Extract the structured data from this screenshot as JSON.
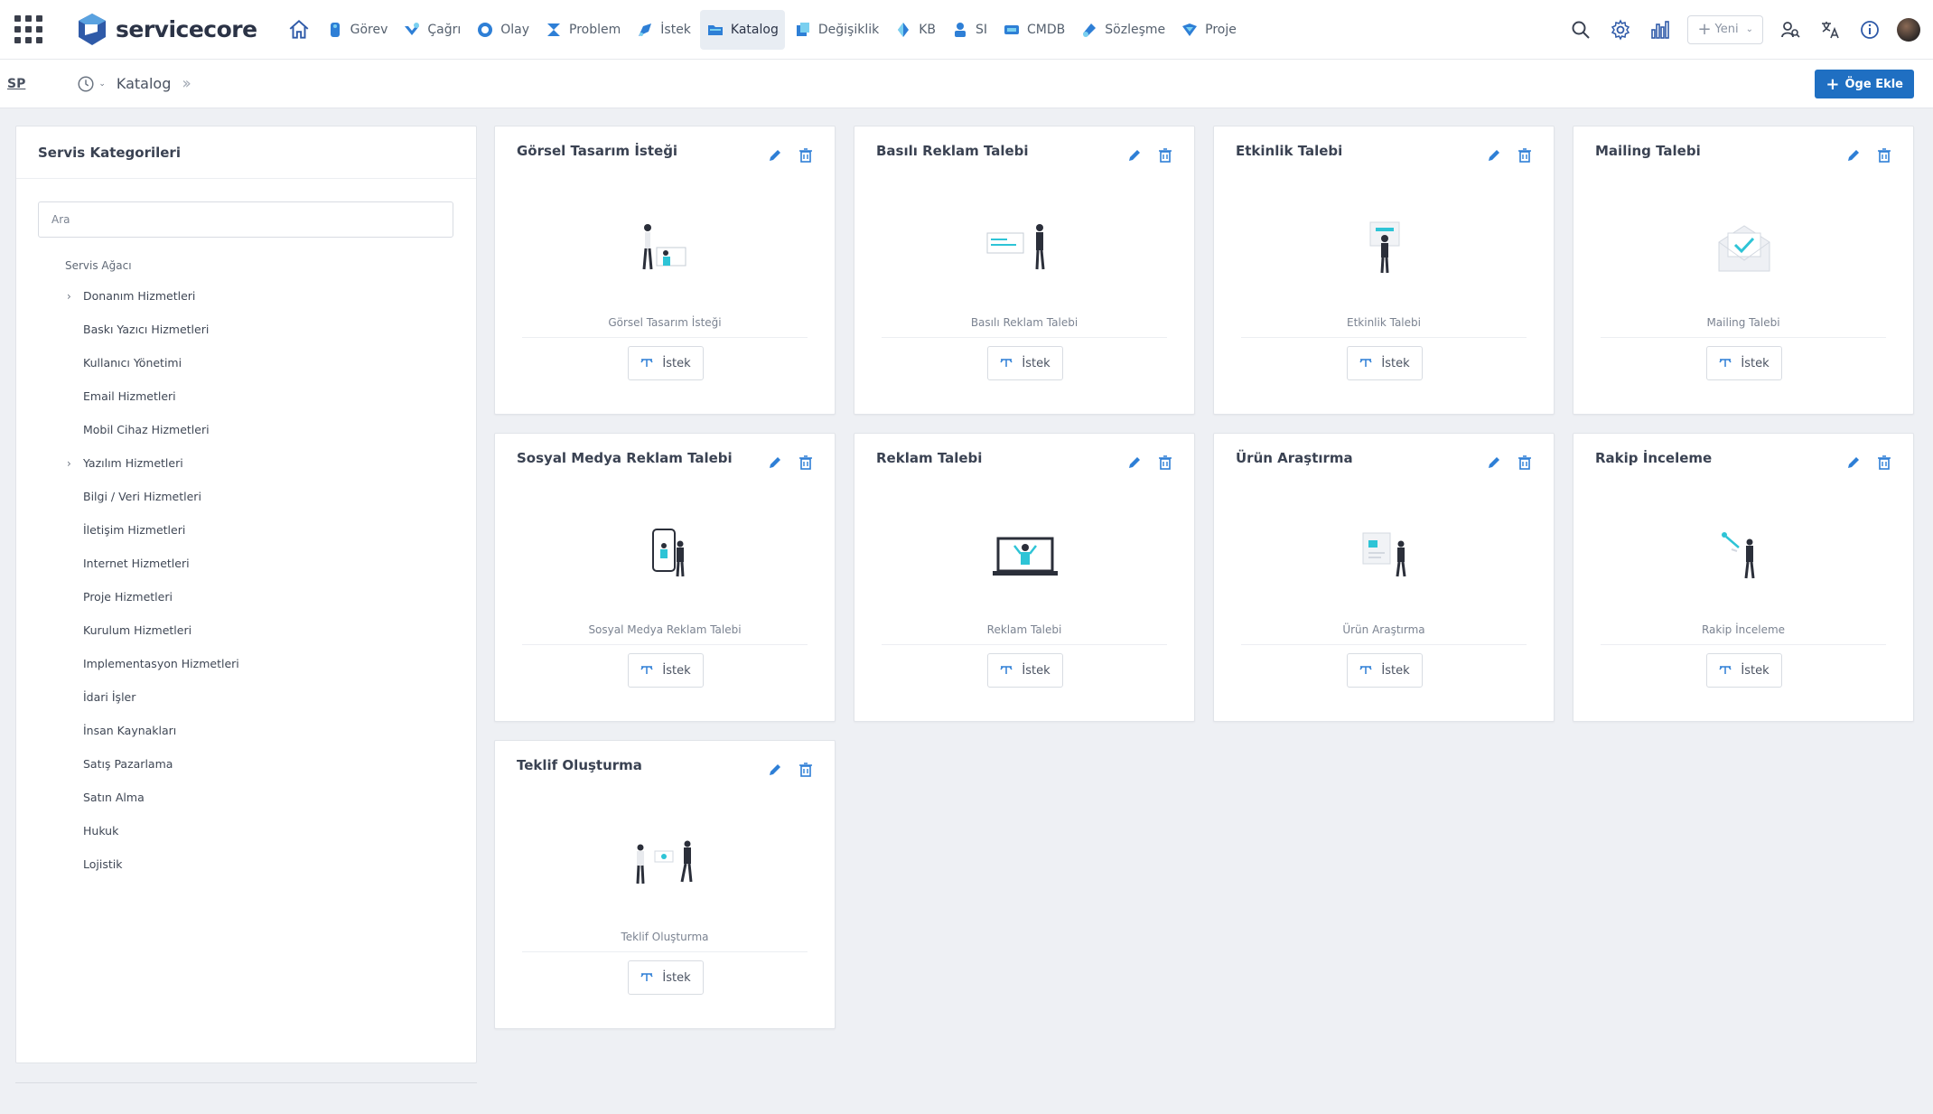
{
  "app": {
    "brand": "servicecore",
    "nav": [
      {
        "label": "",
        "icon": "home-icon"
      },
      {
        "label": "Görev",
        "icon": "task-icon"
      },
      {
        "label": "Çağrı",
        "icon": "call-icon"
      },
      {
        "label": "Olay",
        "icon": "incident-icon"
      },
      {
        "label": "Problem",
        "icon": "problem-icon"
      },
      {
        "label": "İstek",
        "icon": "request-icon"
      },
      {
        "label": "Katalog",
        "icon": "catalog-icon",
        "active": true
      },
      {
        "label": "Değişiklik",
        "icon": "change-icon"
      },
      {
        "label": "KB",
        "icon": "knowledge-base-icon"
      },
      {
        "label": "SI",
        "icon": "si-icon"
      },
      {
        "label": "CMDB",
        "icon": "cmdb-icon"
      },
      {
        "label": "Sözleşme",
        "icon": "contract-icon"
      },
      {
        "label": "Proje",
        "icon": "project-icon"
      }
    ],
    "new_button": "Yeni"
  },
  "subbar": {
    "sp": "SP",
    "breadcrumb": "Katalog",
    "add_item": "Öge Ekle"
  },
  "sidebar": {
    "title": "Servis Kategorileri",
    "search_placeholder": "Ara",
    "tree_root": "Servis Ağacı",
    "items": [
      {
        "label": "Donanım Hizmetleri",
        "expandable": true
      },
      {
        "label": "Baskı Yazıcı Hizmetleri",
        "expandable": false
      },
      {
        "label": "Kullanıcı Yönetimi",
        "expandable": false
      },
      {
        "label": "Email Hizmetleri",
        "expandable": false
      },
      {
        "label": "Mobil Cihaz Hizmetleri",
        "expandable": false
      },
      {
        "label": "Yazılım Hizmetleri",
        "expandable": true
      },
      {
        "label": "Bilgi / Veri Hizmetleri",
        "expandable": false
      },
      {
        "label": "İletişim Hizmetleri",
        "expandable": false
      },
      {
        "label": "Internet Hizmetleri",
        "expandable": false
      },
      {
        "label": "Proje Hizmetleri",
        "expandable": false
      },
      {
        "label": "Kurulum Hizmetleri",
        "expandable": false
      },
      {
        "label": "Implementasyon Hizmetleri",
        "expandable": false
      },
      {
        "label": "İdari İşler",
        "expandable": false
      },
      {
        "label": "İnsan Kaynakları",
        "expandable": false
      },
      {
        "label": "Satış Pazarlama",
        "expandable": false
      },
      {
        "label": "Satın Alma",
        "expandable": false
      },
      {
        "label": "Hukuk",
        "expandable": false
      },
      {
        "label": "Lojistik",
        "expandable": false
      }
    ]
  },
  "cards": [
    {
      "title": "Görsel Tasarım İsteği",
      "caption": "Görsel Tasarım İsteği",
      "button": "İstek",
      "illustration": "design-illustration"
    },
    {
      "title": "Basılı Reklam Talebi",
      "caption": "Basılı Reklam Talebi",
      "button": "İstek",
      "illustration": "print-ad-illustration"
    },
    {
      "title": "Etkinlik Talebi",
      "caption": "Etkinlik Talebi",
      "button": "İstek",
      "illustration": "event-illustration"
    },
    {
      "title": "Mailing Talebi",
      "caption": "Mailing Talebi",
      "button": "İstek",
      "illustration": "mailing-illustration"
    },
    {
      "title": "Sosyal Medya Reklam Talebi",
      "caption": "Sosyal Medya Reklam Talebi",
      "button": "İstek",
      "illustration": "social-media-illustration"
    },
    {
      "title": "Reklam Talebi",
      "caption": "Reklam Talebi",
      "button": "İstek",
      "illustration": "ad-request-illustration"
    },
    {
      "title": "Ürün Araştırma",
      "caption": "Ürün Araştırma",
      "button": "İstek",
      "illustration": "product-research-illustration"
    },
    {
      "title": "Rakip İnceleme",
      "caption": "Rakip İnceleme",
      "button": "İstek",
      "illustration": "competitor-review-illustration"
    },
    {
      "title": "Teklif Oluşturma",
      "caption": "Teklif Oluşturma",
      "button": "İstek",
      "illustration": "proposal-illustration"
    }
  ],
  "colors": {
    "primary": "#1f6fc2",
    "accent": "#2ec4d6",
    "text": "#3a4252"
  }
}
